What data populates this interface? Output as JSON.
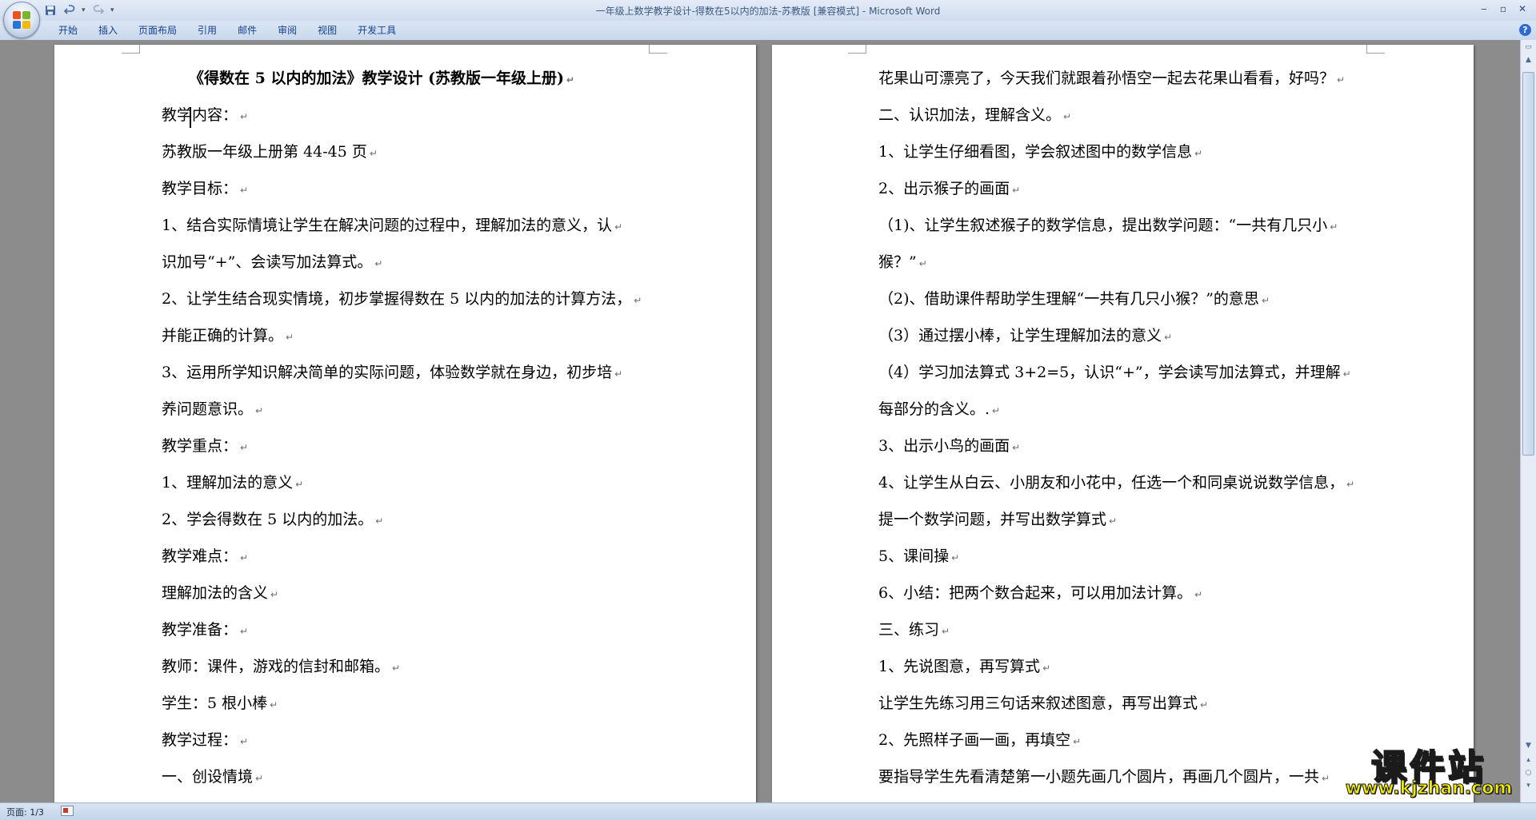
{
  "window": {
    "title": "一年级上数学教学设计-得数在5以内的加法-苏教版 [兼容模式] - Microsoft Word",
    "minimize": "‒",
    "maximize": "▫",
    "close": "✕"
  },
  "quick_access": {
    "save_icon": "save-icon",
    "undo_icon": "undo-icon",
    "redo_icon": "redo-icon",
    "customize_icon": "customize-qat-icon"
  },
  "ribbon": {
    "tabs": [
      "开始",
      "插入",
      "页面布局",
      "引用",
      "邮件",
      "审阅",
      "视图",
      "开发工具"
    ],
    "help": "?"
  },
  "document": {
    "page1": [
      "《得数在 5 以内的加法》教学设计 (苏教版一年级上册)",
      "教学内容：",
      "苏教版一年级上册第 44-45 页",
      "教学目标：",
      "1、结合实际情境让学生在解决问题的过程中，理解加法的意义，认",
      "识加号“+”、会读写加法算式。",
      "2、让学生结合现实情境，初步掌握得数在 5 以内的加法的计算方法，",
      "并能正确的计算。",
      "3、运用所学知识解决简单的实际问题，体验数学就在身边，初步培",
      "养问题意识。",
      "教学重点：",
      "1、理解加法的意义",
      "2、学会得数在 5 以内的加法。",
      "教学难点：",
      "理解加法的含义",
      "教学准备：",
      "教师：课件，游戏的信封和邮箱。",
      "学生：5 根小棒",
      "教学过程：",
      "一、创设情境"
    ],
    "page2": [
      "花果山可漂亮了，今天我们就跟着孙悟空一起去花果山看看，好吗？",
      "二、认识加法，理解含义。",
      "1、让学生仔细看图，学会叙述图中的数学信息",
      "2、出示猴子的画面",
      "（1)、让学生叙述猴子的数学信息，提出数学问题：“一共有几只小",
      "猴？”",
      "（2)、借助课件帮助学生理解“一共有几只小猴？”的意思",
      "（3）通过摆小棒，让学生理解加法的意义",
      "（4）学习加法算式 3+2=5，认识“+”，学会读写加法算式，并理解",
      "每部分的含义。.",
      "3、出示小鸟的画面",
      "4、让学生从白云、小朋友和小花中，任选一个和同桌说说数学信息，",
      "提一个数学问题，并写出数学算式",
      "5、课间操",
      "6、小结：把两个数合起来，可以用加法计算。",
      "三、练习",
      "1、先说图意，再写算式",
      "让学生先练习用三句话来叙述图意，再写出算式",
      "2、先照样子画一画，再填空",
      "要指导学生先看清楚第一小题先画几个圆片，再画几个圆片，一共"
    ],
    "paragraph_mark": "↵"
  },
  "status": {
    "page": "页面: 1/3"
  },
  "watermark": {
    "title": "课件站",
    "url": "www.kjzhan.com"
  }
}
